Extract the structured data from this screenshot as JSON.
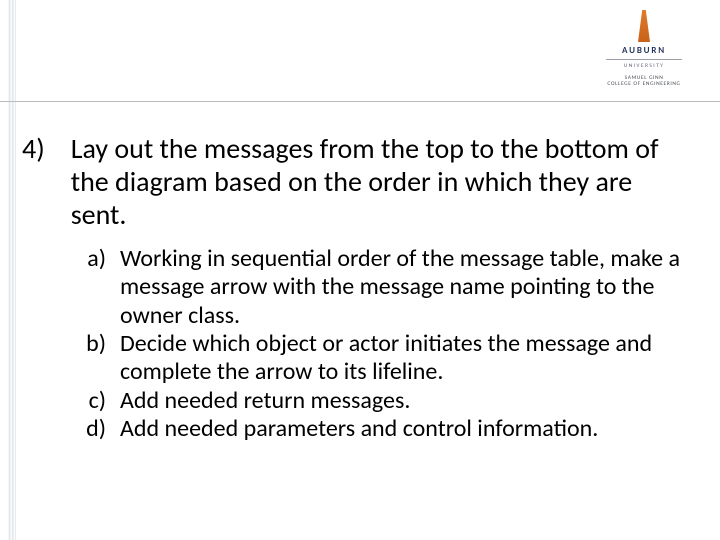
{
  "logo": {
    "wordmark": "AUBURN",
    "university": "UNIVERSITY",
    "college_line1": "SAMUEL GINN",
    "college_line2": "COLLEGE OF ENGINEERING"
  },
  "step": {
    "number": "4)",
    "text": "Lay out the messages from the top to the bottom of the diagram based on the order in which they are sent."
  },
  "subs": [
    {
      "letter": "a)",
      "text": "Working in sequential order of the message table, make a message arrow with the message name pointing to the owner class."
    },
    {
      "letter": "b)",
      "text": "Decide which object or actor initiates the message and complete the arrow to its lifeline."
    },
    {
      "letter": "c)",
      "text": "Add needed return messages."
    },
    {
      "letter": "d)",
      "text": "Add needed parameters and control information."
    }
  ]
}
